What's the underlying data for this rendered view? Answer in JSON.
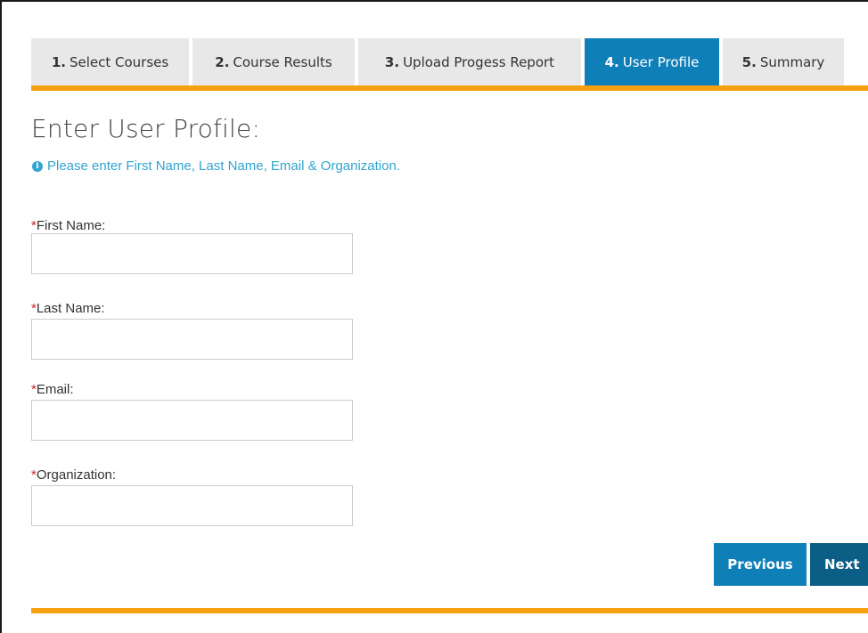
{
  "tabs": [
    {
      "num": "1.",
      "label": "Select Courses",
      "active": false
    },
    {
      "num": "2.",
      "label": "Course Results",
      "active": false
    },
    {
      "num": "3.",
      "label": "Upload Progess Report",
      "active": false
    },
    {
      "num": "4.",
      "label": "User Profile",
      "active": true
    },
    {
      "num": "5.",
      "label": "Summary",
      "active": false
    }
  ],
  "page": {
    "title": "Enter User Profile:",
    "info": "Please enter First Name, Last Name, Email & Organization.",
    "info_icon": "info-circle-icon"
  },
  "form": {
    "required_marker": "*",
    "first_name": {
      "label": "First Name:",
      "value": ""
    },
    "last_name": {
      "label": "Last Name:",
      "value": ""
    },
    "email": {
      "label": "Email:",
      "value": ""
    },
    "organization": {
      "label": "Organization:",
      "value": ""
    }
  },
  "buttons": {
    "previous": "Previous",
    "next": "Next"
  },
  "colors": {
    "accent_blue": "#0f7fb7",
    "dark_blue": "#0b5e86",
    "orange_bar": "#f5a10f",
    "info_text": "#31a4d0",
    "required": "#cc2222"
  }
}
